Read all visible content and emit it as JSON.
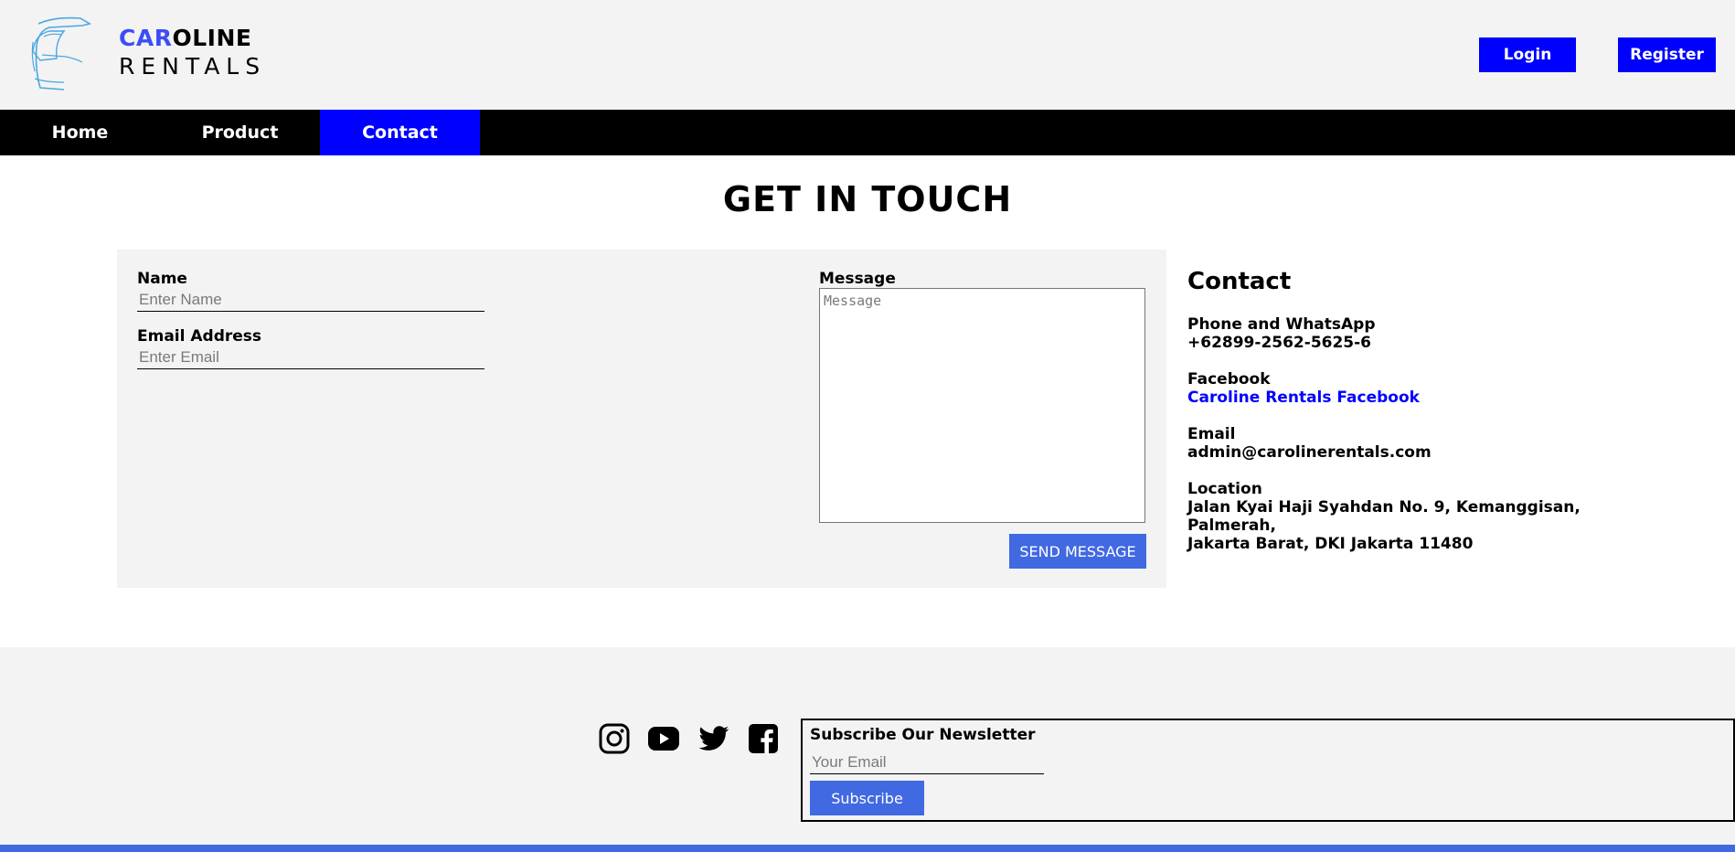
{
  "brand": {
    "line1_accent": "CAR",
    "line1_rest": "OLINE",
    "line2": "RENTALS",
    "accent_color": "#3b4ef6"
  },
  "header": {
    "login_label": "Login",
    "register_label": "Register"
  },
  "nav": {
    "items": [
      {
        "label": "Home"
      },
      {
        "label": "Product"
      },
      {
        "label": "Contact",
        "active": true
      }
    ]
  },
  "page": {
    "title": "GET IN TOUCH"
  },
  "form": {
    "name_label": "Name",
    "name_placeholder": "Enter Name",
    "email_label": "Email Address",
    "email_placeholder": "Enter Email",
    "message_label": "Message",
    "message_placeholder": "Message",
    "send_label": "SEND MESSAGE"
  },
  "contact": {
    "heading": "Contact",
    "phone_label": "Phone and WhatsApp",
    "phone_value": "+62899-2562-5625-6",
    "facebook_label": "Facebook",
    "facebook_link": "Caroline Rentals Facebook",
    "email_label": "Email",
    "email_value": "admin@carolinerentals.com",
    "location_label": "Location",
    "location_line1": "Jalan Kyai Haji Syahdan No. 9, Kemanggisan, Palmerah,",
    "location_line2": "Jakarta Barat, DKI Jakarta 11480"
  },
  "footer": {
    "social": [
      "instagram-icon",
      "youtube-icon",
      "twitter-icon",
      "facebook-icon"
    ],
    "newsletter_title": "Subscribe Our Newsletter",
    "newsletter_placeholder": "Your Email",
    "subscribe_label": "Subscribe"
  },
  "colors": {
    "primary_blue": "#0000ff",
    "button_blue": "#4169e1",
    "nav_bg": "#000000",
    "panel_bg": "#f3f3f3"
  }
}
